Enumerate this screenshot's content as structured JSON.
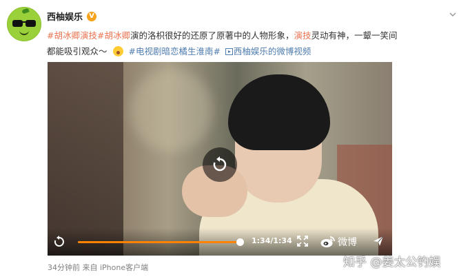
{
  "post": {
    "author": "西柚娱乐",
    "verified_badge": "V",
    "text": {
      "tag1": "#胡冰卿演技#",
      "tag2": "胡冰卿",
      "seg1": "演的洛枳很好的还原了原著中的人物形象，",
      "tag3": "演技",
      "seg2": "灵动有神，一颦一笑间",
      "seg3": "都能吸引观众～",
      "hashtag_link": "#电视剧暗恋橘生淮南#",
      "video_link": "西柚娱乐的微博视频"
    },
    "footer": {
      "time": "34分钟前",
      "source": "来自 iPhone客户端"
    }
  },
  "video": {
    "time_display": "1:34/1:34",
    "progress": 1.0,
    "weibo_label": "微博"
  },
  "watermark": "知乎 @姜太公钓娱",
  "colors": {
    "tag": "#eb7350",
    "link": "#507daf",
    "progress": "#ff8200",
    "badge": "#f7a21b"
  },
  "icons": {
    "avatar": "grapefruit-sunglasses-avatar",
    "verified": "verified-badge-icon",
    "menu": "chevron-down-icon",
    "replay": "replay-icon",
    "fullscreen": "fullscreen-icon",
    "weibo": "weibo-logo-icon",
    "share": "share-icon",
    "emoji": "surprised-emoji-icon"
  }
}
